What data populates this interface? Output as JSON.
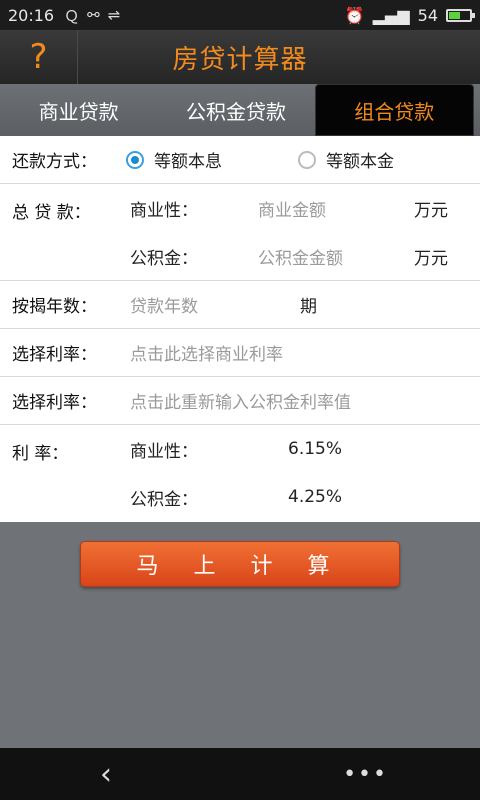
{
  "status_bar": {
    "time": "20:16",
    "icons": [
      "q-icon",
      "share-icon",
      "usb-icon"
    ],
    "battery_level": "54",
    "battery_fill_fraction": 0.54
  },
  "header": {
    "help_label": "?",
    "title": "房贷计算器"
  },
  "tabs": [
    {
      "label": "商业贷款",
      "active": false
    },
    {
      "label": "公积金贷款",
      "active": false
    },
    {
      "label": "组合贷款",
      "active": true
    }
  ],
  "form": {
    "repayment": {
      "label": "还款方式：",
      "options": [
        {
          "label": "等额本息",
          "selected": true
        },
        {
          "label": "等额本金",
          "selected": false
        }
      ]
    },
    "total_loan": {
      "label": "总 贷  款：",
      "commercial": {
        "label": "商业性：",
        "placeholder": "商业金额",
        "unit": "万元"
      },
      "fund": {
        "label": "公积金：",
        "placeholder": "公积金金额",
        "unit": "万元"
      }
    },
    "years": {
      "label": "按揭年数：",
      "placeholder": "贷款年数",
      "unit": "期"
    },
    "rate_select_commercial": {
      "label": "选择利率：",
      "placeholder": "点击此选择商业利率"
    },
    "rate_select_fund": {
      "label": "选择利率：",
      "placeholder": "点击此重新输入公积金利率值"
    },
    "rates": {
      "label": "利     率：",
      "commercial": {
        "label": "商业性：",
        "value": "6.15%"
      },
      "fund": {
        "label": "公积金：",
        "value": "4.25%"
      }
    }
  },
  "calculate_button": "马 上 计 算",
  "nav": {
    "back": "‹",
    "more": "•••"
  },
  "colors": {
    "accent": "#f28a1e",
    "button": "#e25a24",
    "radio": "#1b8bd0"
  }
}
